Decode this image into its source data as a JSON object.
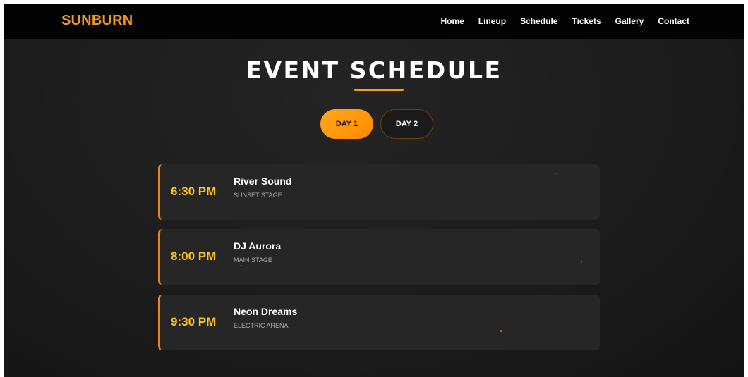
{
  "brand": {
    "logo": "SUNBURN",
    "accent_color": "#f39a1a"
  },
  "nav": {
    "links": [
      "Home",
      "Lineup",
      "Schedule",
      "Tickets",
      "Gallery",
      "Contact"
    ]
  },
  "header": {
    "title": "EVENT SCHEDULE"
  },
  "tabs": [
    {
      "label": "DAY 1",
      "active": true
    },
    {
      "label": "DAY 2",
      "active": false
    }
  ],
  "events": [
    {
      "time": "6:30 PM",
      "name": "River Sound",
      "stage": "SUNSET STAGE"
    },
    {
      "time": "8:00 PM",
      "name": "DJ Aurora",
      "stage": "MAIN STAGE"
    },
    {
      "time": "9:30 PM",
      "name": "Neon Dreams",
      "stage": "ELECTRIC ARENA"
    }
  ],
  "colors": {
    "time": "#ffc21a",
    "card_border": "#f0821a",
    "background": "#1c1c1c"
  }
}
